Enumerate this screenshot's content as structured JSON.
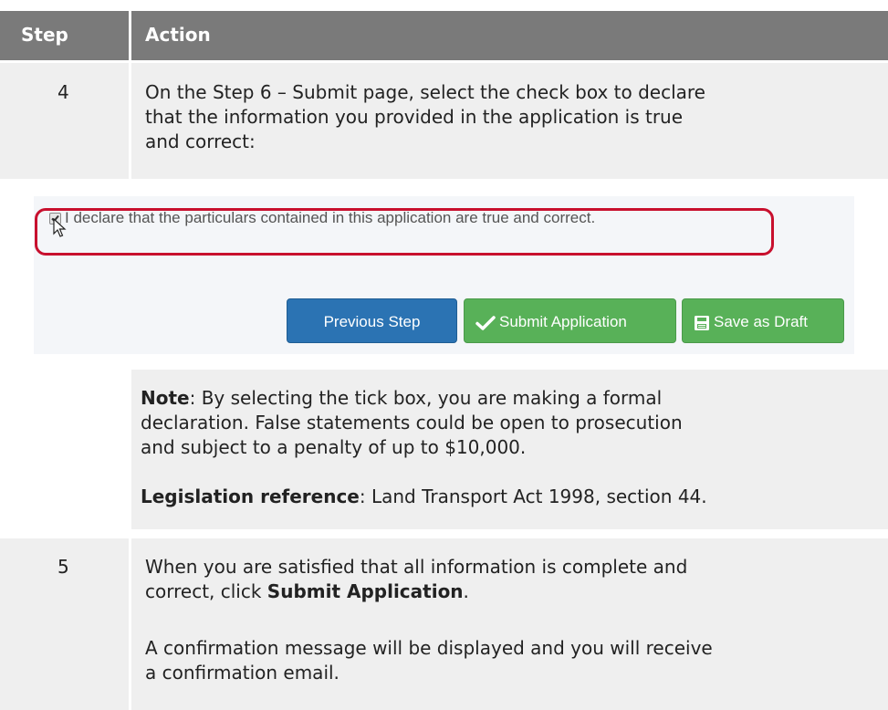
{
  "table": {
    "header": {
      "step": "Step",
      "action": "Action"
    },
    "rows": [
      {
        "step": "4",
        "instruction": "On the Step 6 – Submit page, select the check box to declare that the information you provided in the application is true and correct:",
        "instruction_lines": [
          "On the Step 6 – Submit page, select the check box to declare",
          "that the information you provided in the application is true",
          "and correct:"
        ]
      },
      {
        "step": "5",
        "lines": [
          {
            "before": "When you are satisfied that all information is complete and",
            "bold": "",
            "after": ""
          },
          {
            "before": "correct, click ",
            "bold": "Submit Application",
            "after": "."
          }
        ],
        "result_lines": [
          "A confirmation message will be displayed and you will receive",
          "a confirmation email."
        ]
      }
    ]
  },
  "screenshot": {
    "declaration_text": "I declare that the particulars contained in this application are true and correct.",
    "checkbox_checked": true,
    "buttons": {
      "previous": "Previous Step",
      "submit": "Submit Application",
      "draft": "Save as Draft"
    },
    "colors": {
      "highlight": "#c8102e",
      "primary": "#2b73b3",
      "success": "#58b158"
    }
  },
  "note": {
    "label": "Note",
    "lines": [
      ": By selecting the tick box, you are making a formal",
      "declaration. False statements could be open to prosecution",
      "and subject to a penalty of up to $10,000."
    ]
  },
  "legislation": {
    "label": "Legislation reference",
    "text": ": Land Transport Act 1998, section 44."
  }
}
